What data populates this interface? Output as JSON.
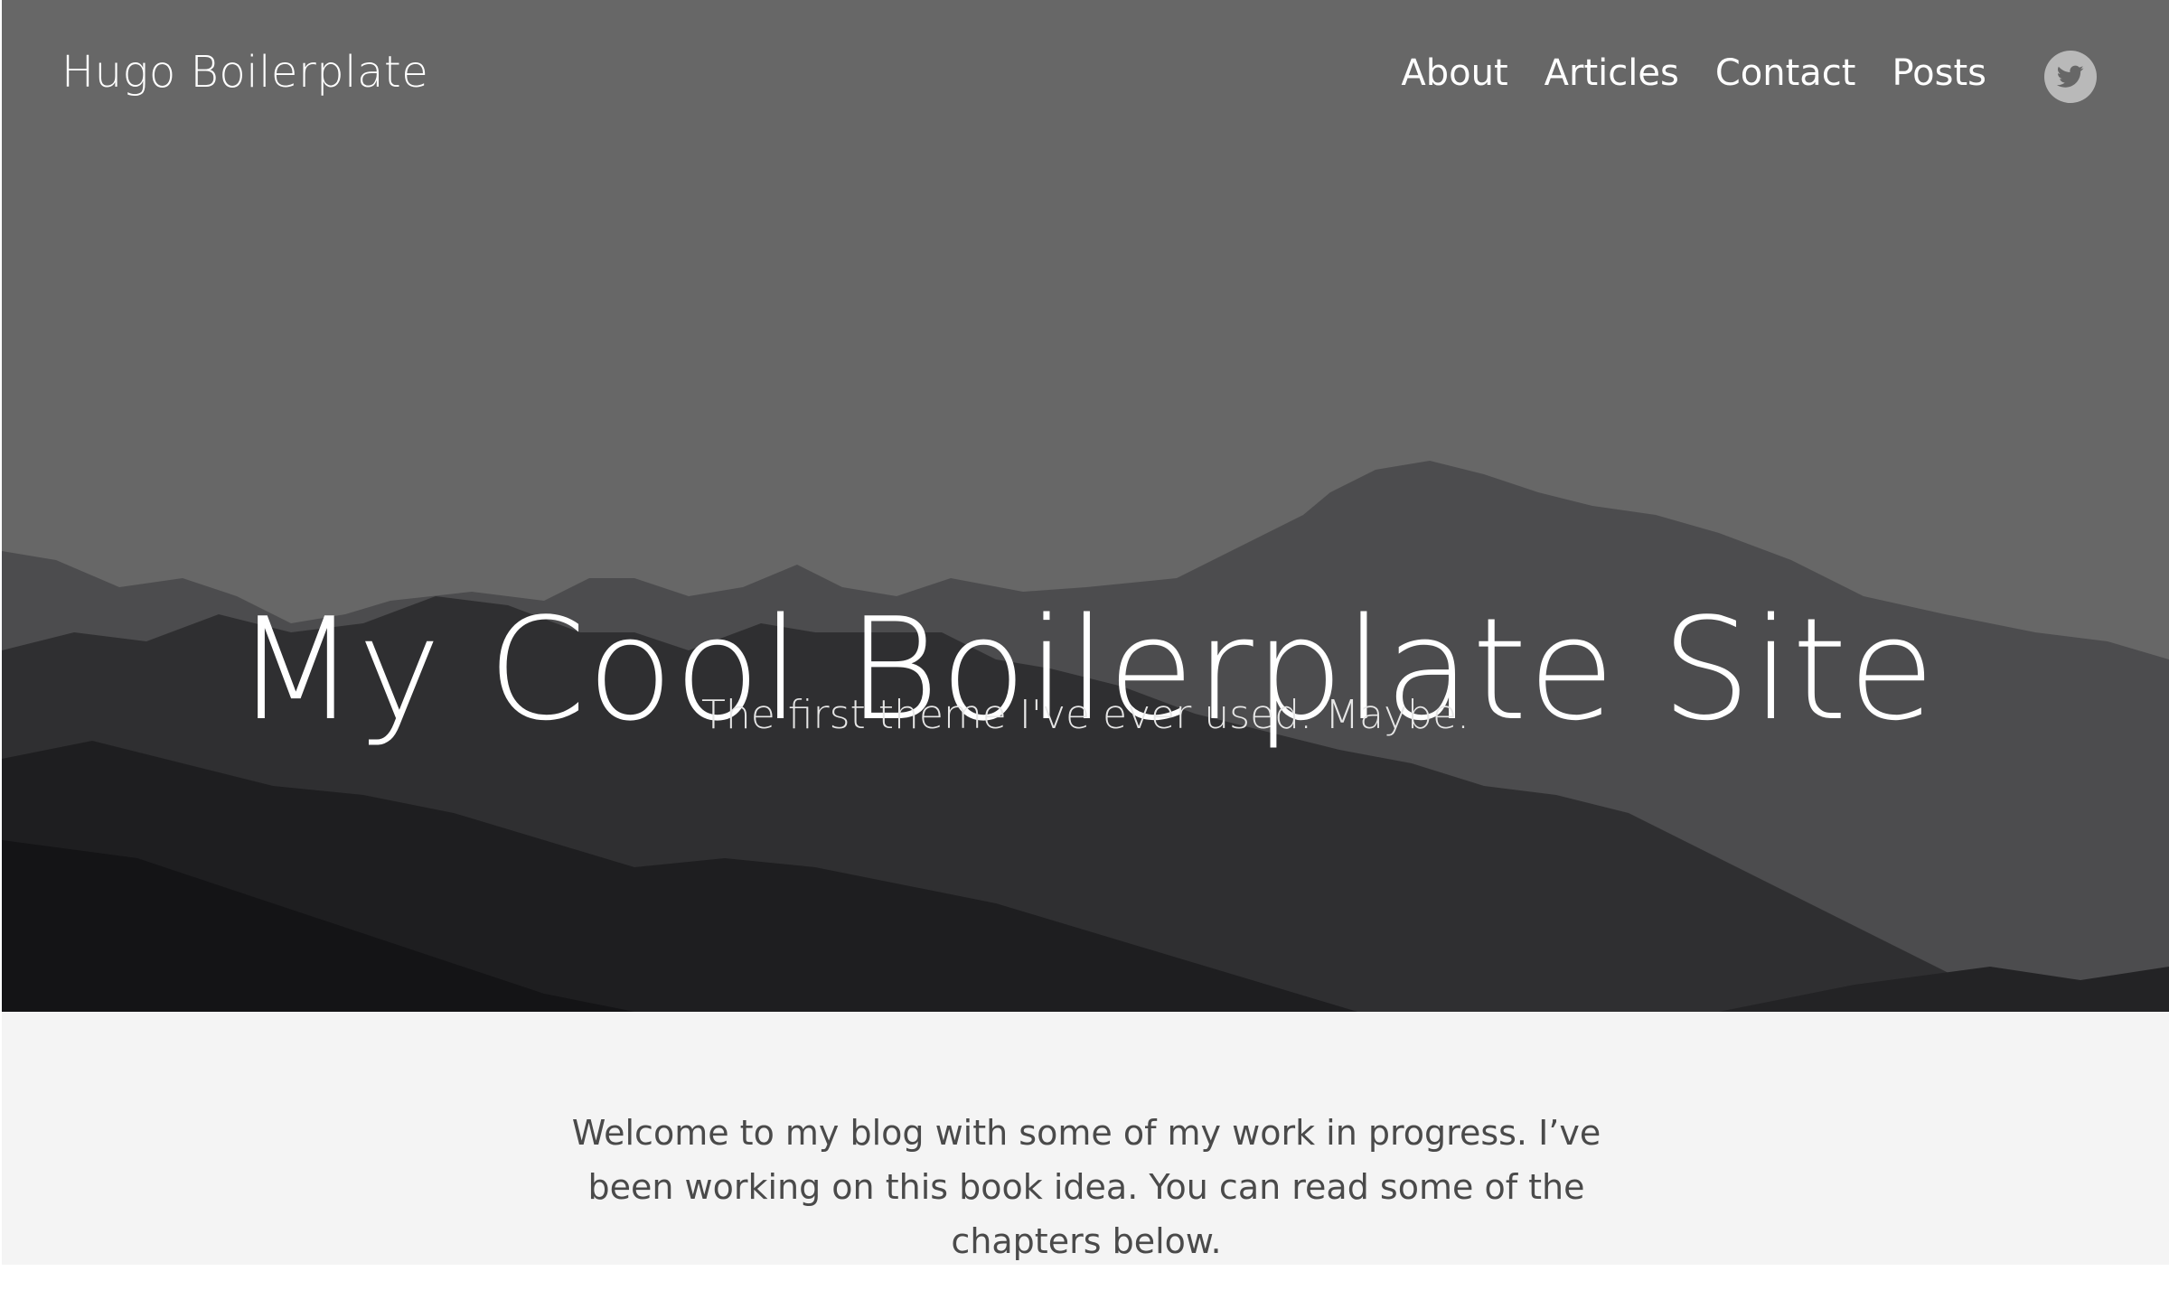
{
  "header": {
    "site_title": "Hugo Boilerplate",
    "nav": [
      {
        "label": "About"
      },
      {
        "label": "Articles"
      },
      {
        "label": "Contact"
      },
      {
        "label": "Posts"
      }
    ],
    "social_icon": "twitter-icon"
  },
  "hero": {
    "title": "My Cool Boilerplate Site",
    "subtitle": "The first theme I've ever used. Maybe."
  },
  "content": {
    "intro": "Welcome to my blog with some of my work in progress. I’ve been working on this book idea. You can read some of the chapters below."
  },
  "colors": {
    "sky": "#676767",
    "content_bg": "#f4f4f4",
    "text": "#4a4a4a",
    "icon_bg": "#b9b9b9"
  }
}
